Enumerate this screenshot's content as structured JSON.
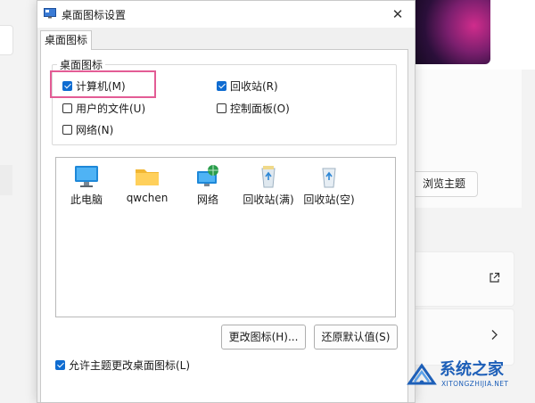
{
  "background": {
    "browse_theme_label": "浏览主题"
  },
  "dialog": {
    "title": "桌面图标设置",
    "tab_label": "桌面图标",
    "group_label": "桌面图标",
    "checkboxes": [
      {
        "label": "计算机(M)",
        "checked": true
      },
      {
        "label": "回收站(R)",
        "checked": true
      },
      {
        "label": "用户的文件(U)",
        "checked": false
      },
      {
        "label": "控制面板(O)",
        "checked": false
      },
      {
        "label": "网络(N)",
        "checked": false
      }
    ],
    "icons": [
      {
        "label": "此电脑",
        "icon": "monitor-icon"
      },
      {
        "label": "qwchen",
        "icon": "folder-icon"
      },
      {
        "label": "网络",
        "icon": "network-globe-icon"
      },
      {
        "label": "回收站(满)",
        "icon": "recycle-bin-full-icon"
      },
      {
        "label": "回收站(空)",
        "icon": "recycle-bin-empty-icon"
      }
    ],
    "change_icon_button": "更改图标(H)...",
    "restore_default_button": "还原默认值(S)",
    "allow_themes": {
      "label": "允许主题更改桌面图标(L)",
      "checked": true
    }
  },
  "watermark": {
    "title": "系统之家",
    "url": "XITONGZHIJIA.NET"
  },
  "colors": {
    "accent": "#0f6cd1",
    "highlight": "#e35c95",
    "watermark_blue": "#1d5fb8"
  }
}
